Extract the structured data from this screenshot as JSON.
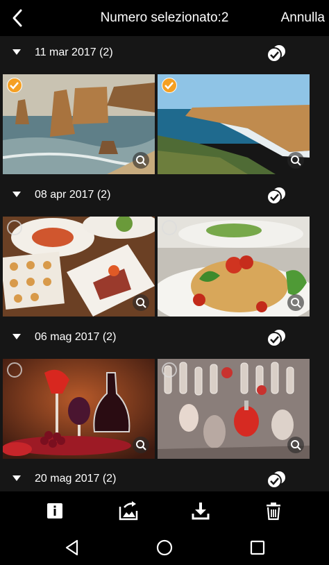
{
  "header": {
    "title": "Numero selezionato:2",
    "cancel_label": "Annulla",
    "back_icon": "chevron-left-icon"
  },
  "groups": [
    {
      "date": "11 mar 2017 (2)",
      "photos": [
        {
          "subject": "coastal sea stacks",
          "selected": true
        },
        {
          "subject": "coastal cliffs",
          "selected": true
        }
      ]
    },
    {
      "date": "08 apr 2017 (2)",
      "photos": [
        {
          "subject": "appetizer plates",
          "selected": false
        },
        {
          "subject": "spaghetti with tomato",
          "selected": false
        }
      ]
    },
    {
      "date": "06 mag 2017 (2)",
      "photos": [
        {
          "subject": "wine glasses and grapes",
          "selected": false
        },
        {
          "subject": "glass perfume bottles",
          "selected": false
        }
      ]
    },
    {
      "date": "20 mag 2017 (2)",
      "photos": []
    }
  ],
  "toolbar": {
    "icons": [
      "info-icon",
      "share-image-icon",
      "download-icon",
      "trash-icon"
    ]
  },
  "android_nav": {
    "icons": [
      "nav-back-icon",
      "nav-home-icon",
      "nav-recents-icon"
    ]
  },
  "colors": {
    "background": "#161616",
    "bars": "#000000",
    "selected_check": "#f5a023"
  }
}
